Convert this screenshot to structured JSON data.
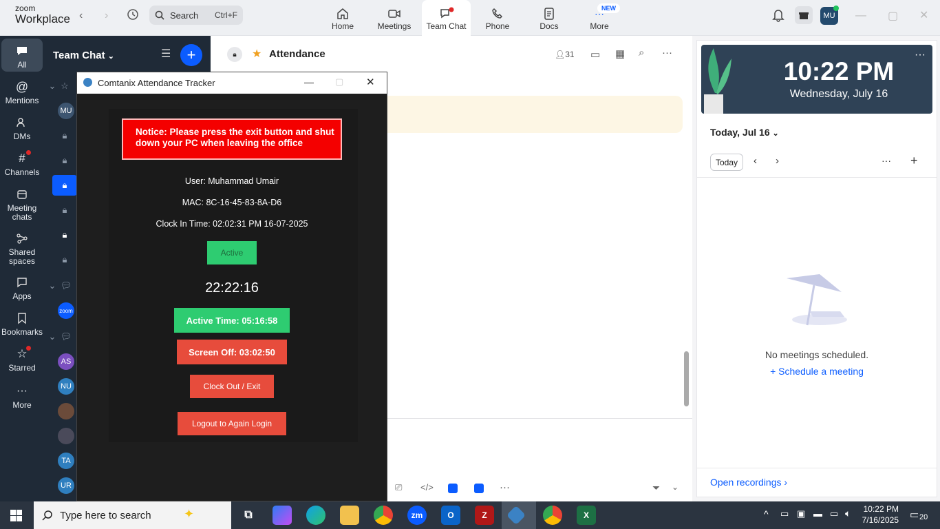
{
  "topbar": {
    "logo_line1": "zoom",
    "logo_line2": "Workplace",
    "search_label": "Search",
    "search_shortcut": "Ctrl+F",
    "new_badge": "NEW",
    "avatar": "MU",
    "nav": [
      {
        "label": "Home",
        "icon": "home-icon"
      },
      {
        "label": "Meetings",
        "icon": "video-icon"
      },
      {
        "label": "Team Chat",
        "icon": "chat-icon"
      },
      {
        "label": "Phone",
        "icon": "phone-icon"
      },
      {
        "label": "Docs",
        "icon": "doc-icon"
      },
      {
        "label": "More",
        "icon": "more-icon"
      }
    ]
  },
  "rail": {
    "items": [
      {
        "label": "All",
        "icon": "chat-icon"
      },
      {
        "label": "Mentions",
        "icon": "at-icon"
      },
      {
        "label": "DMs",
        "icon": "people-icon"
      },
      {
        "label": "Channels",
        "icon": "hash-icon"
      },
      {
        "label": "Meeting chats",
        "icon": "calendar-icon"
      },
      {
        "label": "Shared spaces",
        "icon": "share-icon"
      },
      {
        "label": "Apps",
        "icon": "apps-icon"
      },
      {
        "label": "Bookmarks",
        "icon": "bookmark-icon"
      },
      {
        "label": "Starred",
        "icon": "star-icon"
      },
      {
        "label": "More",
        "icon": "more-icon"
      }
    ]
  },
  "chatpanel": {
    "title": "Team Chat",
    "avatars": [
      {
        "text": "MU",
        "color": "#3d5570"
      },
      {
        "text": "zoom",
        "color": "#0b5cff"
      },
      {
        "text": "AS",
        "color": "#7b4fbf"
      },
      {
        "text": "NU",
        "color": "#2f7fbf"
      },
      {
        "text": "",
        "color": "#6b4b3a"
      },
      {
        "text": "",
        "color": "#4a4a5a"
      },
      {
        "text": "TA",
        "color": "#2f7fbf"
      },
      {
        "text": "UR",
        "color": "#2f7fbf"
      }
    ]
  },
  "main": {
    "channel_title": "Attendance",
    "member_count": "31"
  },
  "right": {
    "time": "10:22 PM",
    "date": "Wednesday, July 16",
    "cal_head": "Today, Jul 16",
    "today_btn": "Today",
    "no_meetings": "No meetings scheduled.",
    "schedule": "Schedule a meeting",
    "open_recordings": "Open recordings"
  },
  "tracker": {
    "title": "Comtanix Attendance Tracker",
    "notice": "Notice: Please press the exit button and shut down your PC when leaving the office",
    "user": "User: Muhammad Umair",
    "mac": "MAC: 8C-16-45-83-8A-D6",
    "clock_in": "Clock In Time: 02:02:31 PM 16-07-2025",
    "status": "Active",
    "clock": "22:22:16",
    "active_time": "Active Time: 05:16:58",
    "screen_off": "Screen Off: 03:02:50",
    "clock_out": "Clock Out / Exit",
    "logout": "Logout to Again Login"
  },
  "taskbar": {
    "search_placeholder": "Type here to search",
    "time": "10:22 PM",
    "date": "7/16/2025",
    "notif_count": "20"
  }
}
